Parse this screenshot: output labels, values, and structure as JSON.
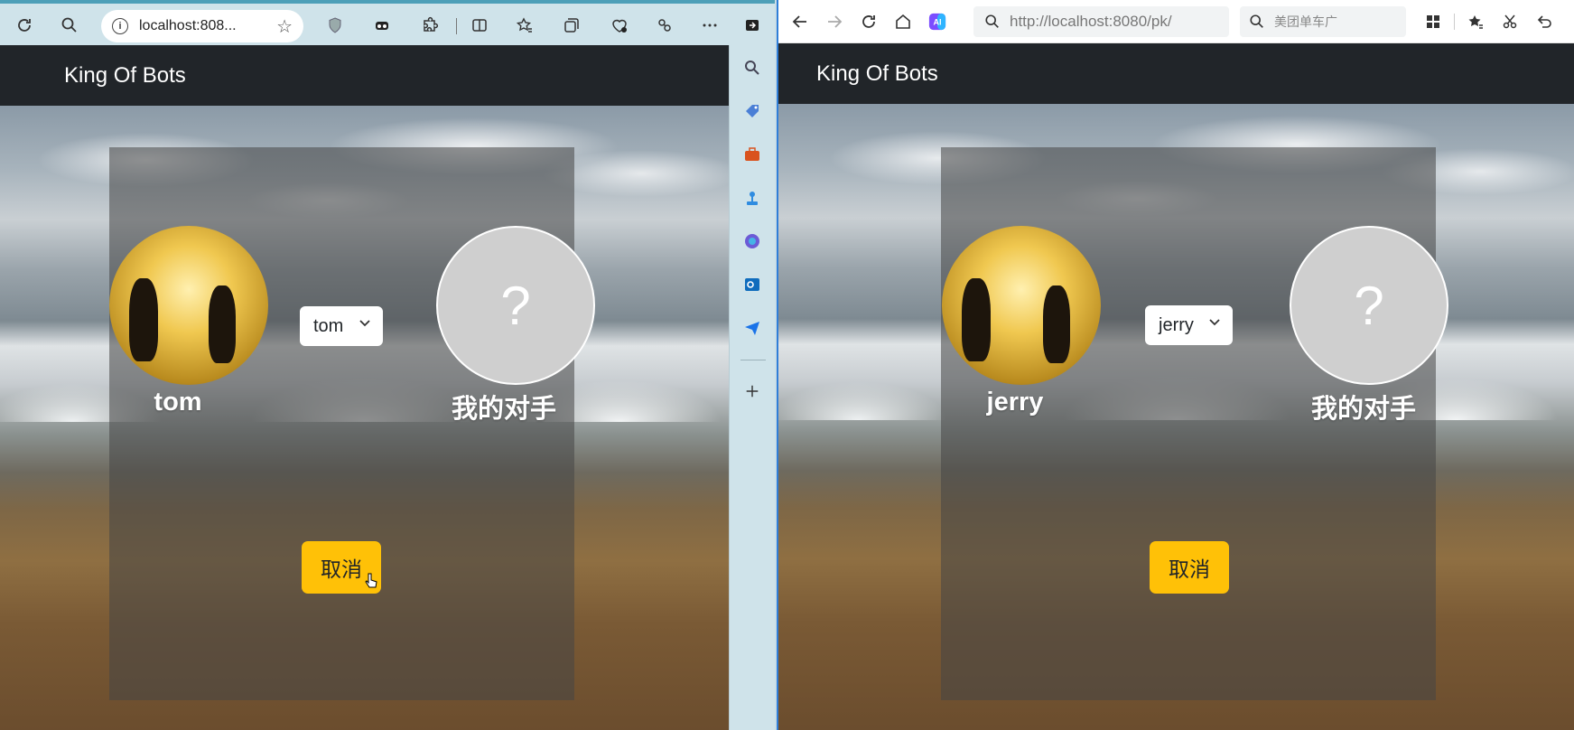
{
  "left_browser": {
    "address": "localhost:808...",
    "page": {
      "brand": "King Of Bots",
      "player_name": "tom",
      "bot_select_value": "tom",
      "opponent_name": "我的对手",
      "opponent_placeholder": "?",
      "cancel_label": "取消"
    }
  },
  "right_browser": {
    "address": "http://localhost:8080/pk/",
    "search_placeholder": "美团单车广",
    "page": {
      "brand": "King Of Bots",
      "player_name": "jerry",
      "bot_select_value": "jerry",
      "opponent_name": "我的对手",
      "opponent_placeholder": "?",
      "cancel_label": "取消"
    }
  },
  "colors": {
    "navbar": "#212529",
    "cancel_button": "#ffc107",
    "opponent_avatar": "#cfcfcf"
  }
}
